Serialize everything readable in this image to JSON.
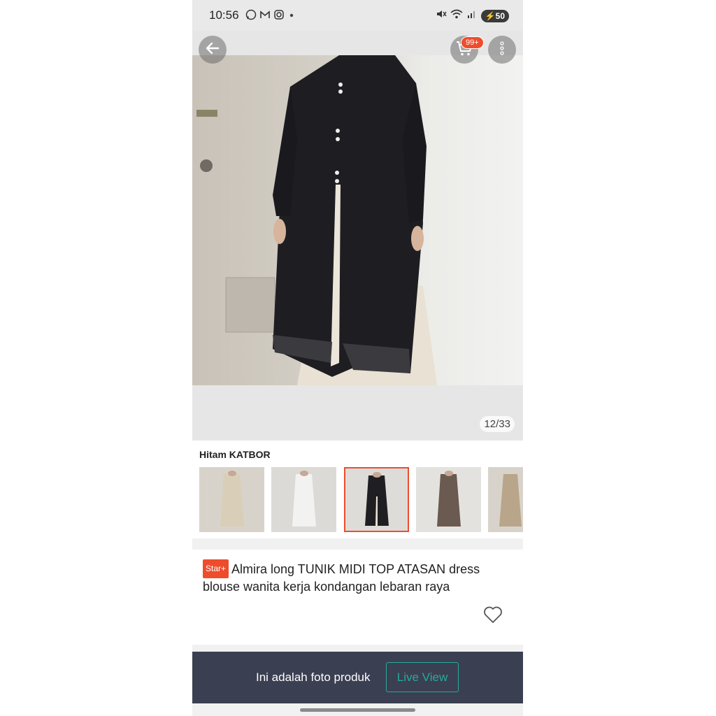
{
  "status": {
    "time": "10:56",
    "app_icons": [
      "whatsapp-icon",
      "gmail-icon",
      "instagram-icon",
      "dot-icon"
    ],
    "system_icons": [
      "mute-icon",
      "wifi-icon",
      "signal-icon"
    ],
    "battery": "50"
  },
  "header": {
    "back_icon": "arrow-left-icon",
    "cart_icon": "cart-icon",
    "cart_badge": "99+",
    "more_icon": "more-vertical-icon"
  },
  "gallery": {
    "counter": "12/33"
  },
  "variant": {
    "selected_label": "Hitam KATBOR",
    "thumbnail_count_visible": 5,
    "selected_index": 2
  },
  "product": {
    "badge": "Star+",
    "title": "Almira long TUNIK MIDI TOP ATASAN dress blouse wanita kerja kondangan lebaran raya",
    "favorite_icon": "heart-icon"
  },
  "live_bar": {
    "text": "Ini adalah foto produk",
    "button": "Live View"
  },
  "colors": {
    "accent": "#ee4d2d",
    "live_button": "#26aa99",
    "live_bar_bg": "#3b3f52"
  }
}
